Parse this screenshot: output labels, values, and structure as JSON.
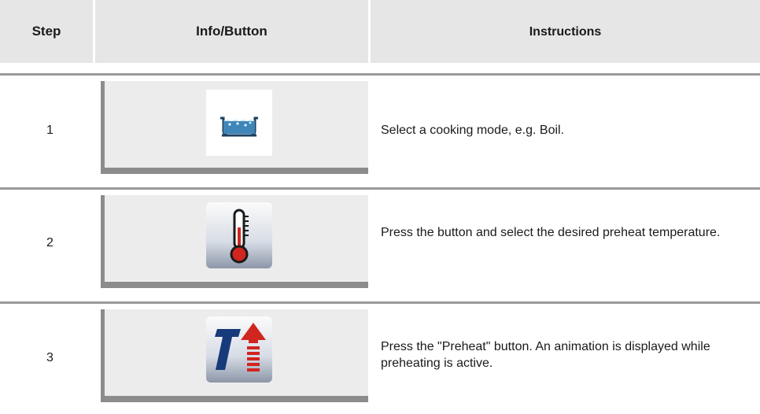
{
  "table": {
    "headers": {
      "step": "Step",
      "info": "Info/Button",
      "instructions": "Instructions"
    },
    "rows": [
      {
        "step": "1",
        "icon": "boil-pot-icon",
        "instruction": "Select a cooking mode, e.g. Boil."
      },
      {
        "step": "2",
        "icon": "thermometer-icon",
        "instruction": "Press the button and select the desired preheat temperature."
      },
      {
        "step": "3",
        "icon": "preheat-icon",
        "instruction": "Press the \"Preheat\" button. An animation is displayed while preheating is active."
      }
    ]
  },
  "colors": {
    "header_bg": "#e6e6e6",
    "rule": "#9a9a9a",
    "panel_bg": "#ececec",
    "panel_shade": "#8c8c8c"
  }
}
